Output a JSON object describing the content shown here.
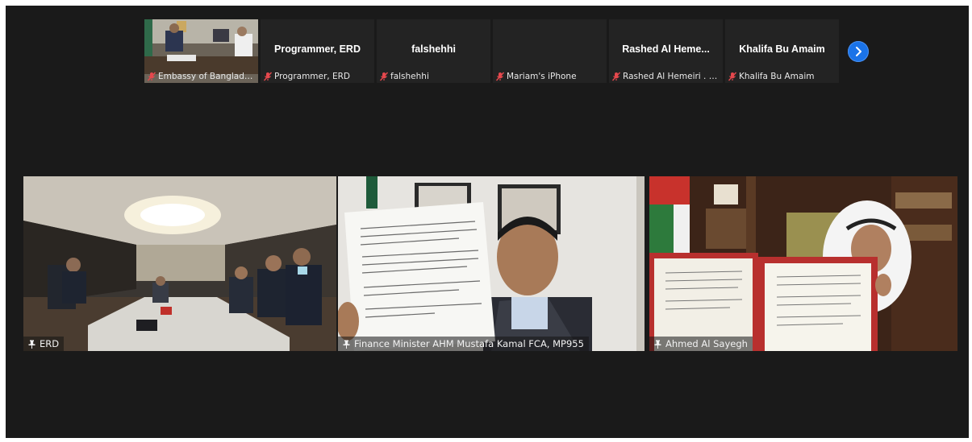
{
  "top_strip": {
    "tiles": [
      {
        "label": "Embassy of Banglade...",
        "center_name": "",
        "has_video": true
      },
      {
        "label": "Programmer, ERD",
        "center_name": "Programmer, ERD"
      },
      {
        "label": "falshehhi",
        "center_name": "falshehhi"
      },
      {
        "label": "Mariam's iPhone",
        "center_name": ""
      },
      {
        "label": "Rashed Al Hemeiri . U...",
        "center_name": "Rashed Al Heme..."
      },
      {
        "label": "Khalifa Bu Amaim",
        "center_name": "Khalifa Bu Amaim"
      }
    ],
    "next_icon": "chevron-right-icon"
  },
  "main_tiles": [
    {
      "label": "ERD",
      "active": true
    },
    {
      "label": "Finance Minister AHM Mustafa Kamal FCA, MP955"
    },
    {
      "label": "Ahmed Al Sayegh"
    }
  ],
  "colors": {
    "background": "#1a1a1a",
    "tile": "#232323",
    "active_border": "#c8e06a",
    "mute": "#e5484d",
    "next_button": "#1a73e8"
  }
}
